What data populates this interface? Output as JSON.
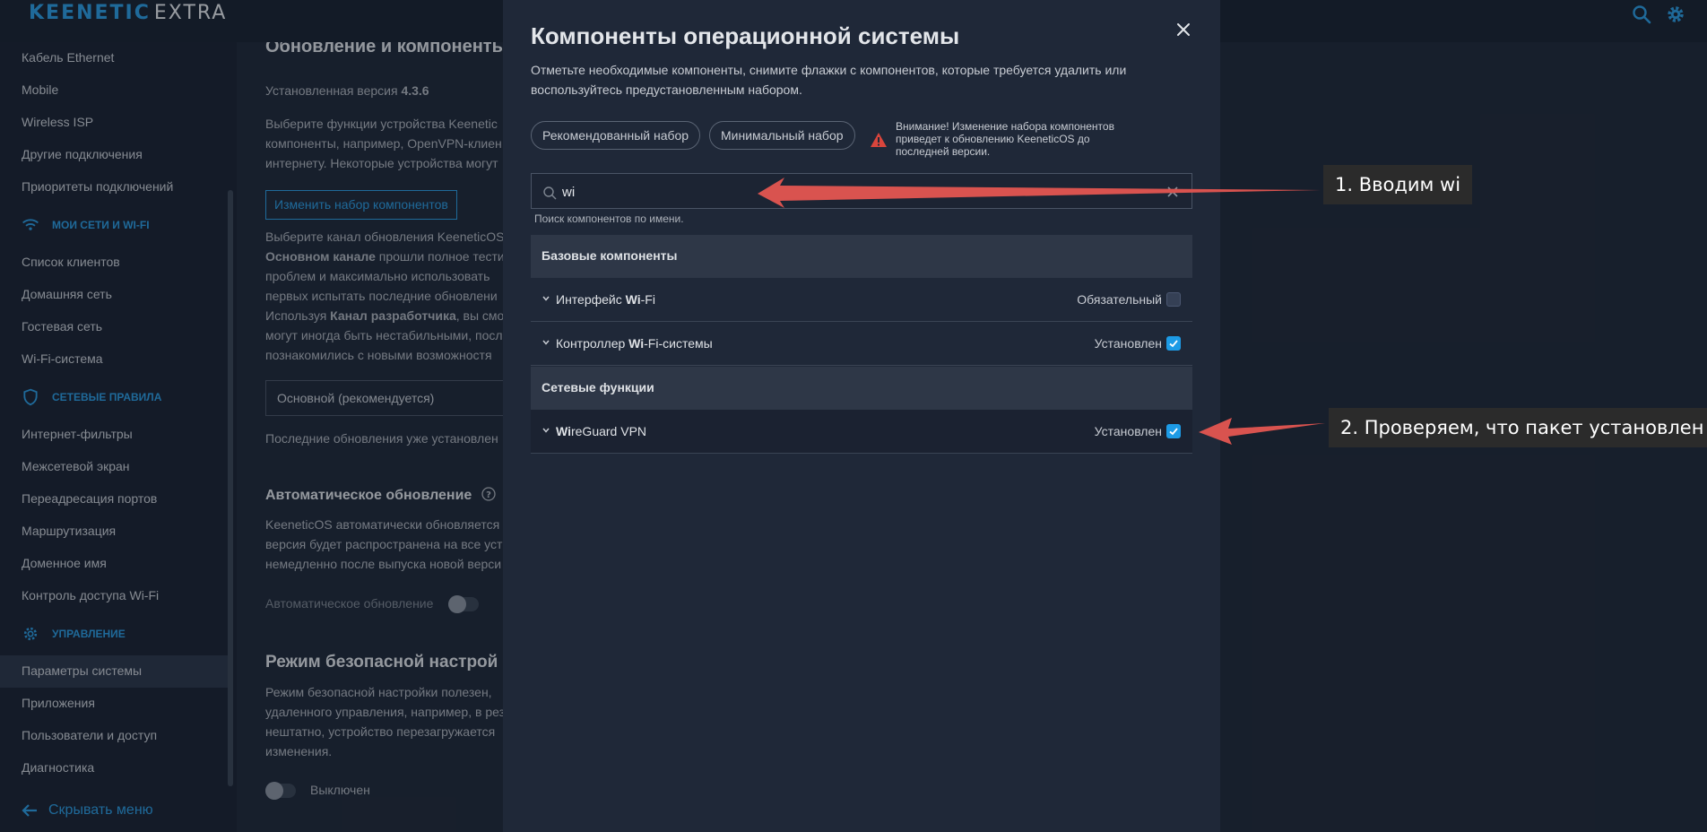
{
  "header": {
    "logo_brand": "KEENETIC",
    "logo_model": "EXTRA",
    "search_icon": "search-icon",
    "settings_icon": "gear-icon"
  },
  "sidebar": {
    "items_top": [
      "Кабель Ethernet",
      "Mobile",
      "Wireless ISP",
      "Другие подключения",
      "Приоритеты подключений"
    ],
    "section_networks": "МОИ СЕТИ И WI-FI",
    "items_networks": [
      "Список клиентов",
      "Домашняя сеть",
      "Гостевая сеть",
      "Wi-Fi-система"
    ],
    "section_rules": "СЕТЕВЫЕ ПРАВИЛА",
    "items_rules": [
      "Интернет-фильтры",
      "Межсетевой экран",
      "Переадресация портов",
      "Маршрутизация",
      "Доменное имя",
      "Контроль доступа Wi-Fi"
    ],
    "section_manage": "УПРАВЛЕНИЕ",
    "items_manage": [
      "Параметры системы",
      "Приложения",
      "Пользователи и доступ",
      "Диагностика"
    ],
    "active_item": "Параметры системы",
    "footer": "Скрывать меню",
    "accent_color": "#2c9be0"
  },
  "background_page": {
    "heading": "Обновление и компоненты",
    "installed_version_label": "Установленная версия",
    "installed_version": "4.3.6",
    "p1": [
      "Выберите функции устройства Keenetic",
      "компоненты, например, OpenVPN-клиен",
      "интернету. Некоторые устройства могут"
    ],
    "change_set_button": "Изменить набор компонентов",
    "p2_l1": "Выберите канал обновления KeeneticOS",
    "p2_l2_bold": "Основном канале",
    "p2_l2": " прошли полное тестир",
    "p2_l3": "проблем и максимально использовать",
    "p2_l4": "первых испытать последние обновлени",
    "p2_l5_pre": "Используя ",
    "p2_l5_bold": "Канал разработчика",
    "p2_l5": ", вы смо",
    "p2_l6": "могут иногда быть нестабильными, посл",
    "p2_l7": "познакомились с новыми возможностя",
    "channel_select": "Основной (рекомендуется)",
    "latest_note": "Последние обновления уже установлен",
    "auto_update_heading": "Автоматическое обновление",
    "p3": [
      "KeeneticOS автоматически обновляется",
      "версия будет распространена на все уст",
      "немедленно после выпуска новой верси"
    ],
    "auto_update_toggle_label": "Автоматическое обновление",
    "safe_mode_heading": "Режим безопасной настрой",
    "p4": [
      "Режим безопасной настройки полезен, ",
      "удаленного управления, например, в рез",
      "нештатно, устройство перезагружается",
      "изменения."
    ],
    "safe_mode_state": "Выключен"
  },
  "modal": {
    "title": "Компоненты операционной системы",
    "description": "Отметьте необходимые компоненты, снимите флажки с компонентов, которые требуется удалить или воспользуйтесь предустановленным набором.",
    "preset_recommended": "Рекомендованный набор",
    "preset_minimal": "Минимальный набор",
    "warning": "Внимание! Изменение набора компонентов приведет к обновлению KeeneticOS до последней версии.",
    "search_value": "wi",
    "search_hint": "Поиск компонентов по имени.",
    "groups": [
      {
        "title": "Базовые компоненты",
        "items": [
          {
            "pre": "Интерфейс ",
            "match": "Wi",
            "post": "-Fi",
            "status": "Обязательный",
            "checked": false
          },
          {
            "pre": "Контроллер ",
            "match": "Wi",
            "post": "-Fi-системы",
            "status": "Установлен",
            "checked": true
          }
        ]
      },
      {
        "title": "Сетевые функции",
        "items": [
          {
            "pre": "",
            "match": "Wi",
            "post": "reGuard VPN",
            "status": "Установлен",
            "checked": true
          }
        ]
      }
    ]
  },
  "annotations": {
    "step1": "1. Вводим wi",
    "step2": "2. Проверяем, что пакет установлен",
    "arrow_color": "#d9534f"
  }
}
